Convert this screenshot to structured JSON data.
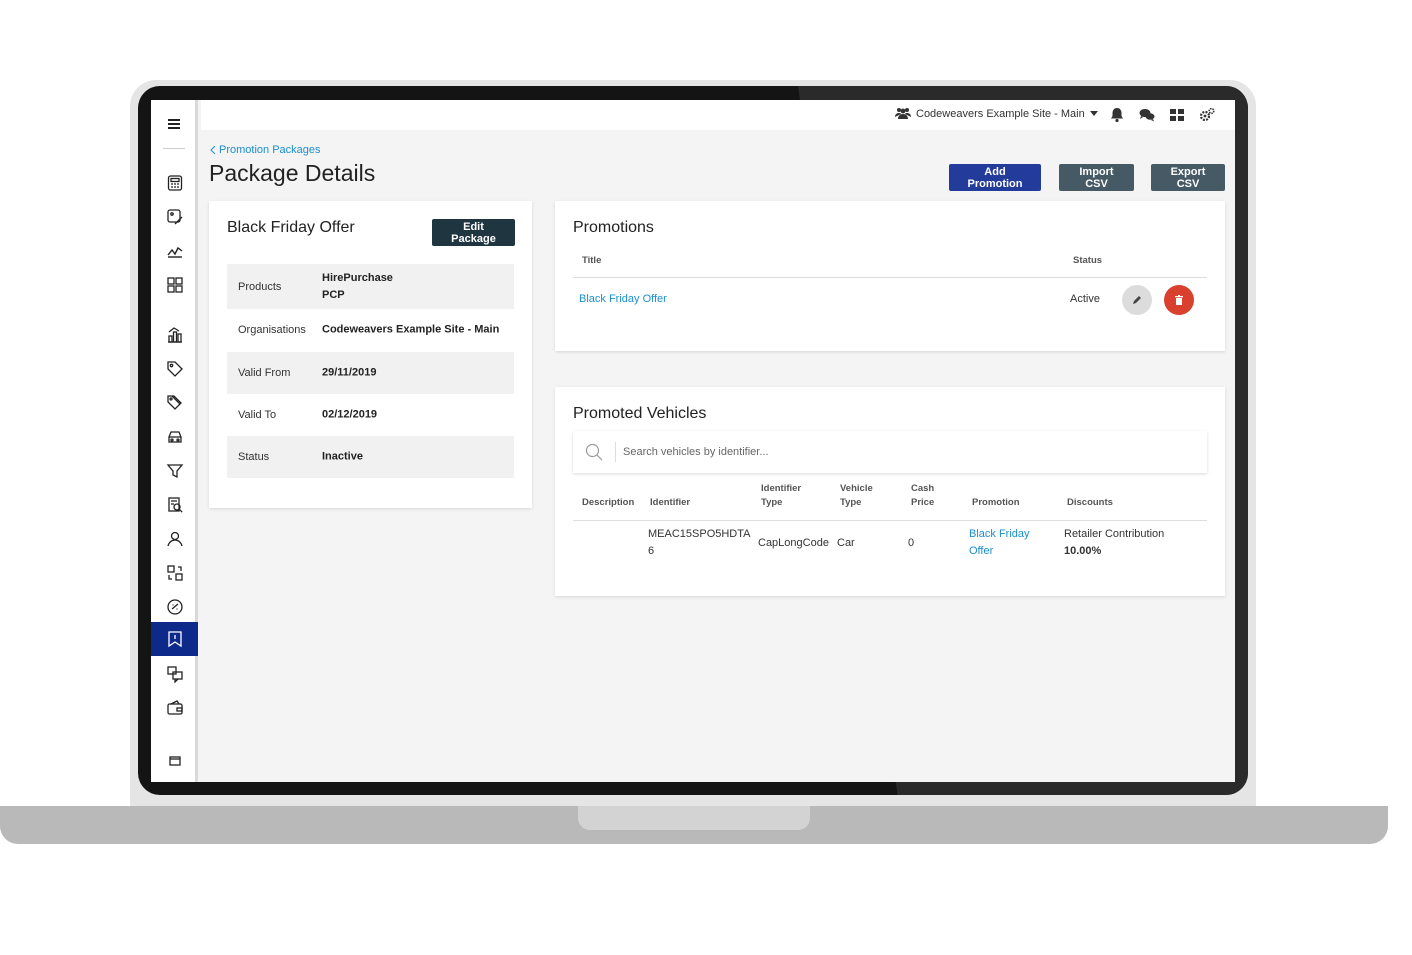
{
  "topbar": {
    "site_name": "Codeweavers Example Site - Main"
  },
  "breadcrumb": {
    "label": "Promotion Packages"
  },
  "page": {
    "title": "Package Details"
  },
  "actions": {
    "add_promotion": "Add Promotion",
    "import_csv": "Import CSV",
    "export_csv": "Export CSV"
  },
  "package": {
    "title": "Black Friday Offer",
    "edit_label": "Edit Package",
    "rows": [
      {
        "label": "Products",
        "value_lines": [
          "HirePurchase",
          "PCP"
        ]
      },
      {
        "label": "Organisations",
        "value": "Codeweavers Example Site - Main"
      },
      {
        "label": "Valid From",
        "value": "29/11/2019"
      },
      {
        "label": "Valid To",
        "value": "02/12/2019"
      },
      {
        "label": "Status",
        "value": "Inactive"
      }
    ]
  },
  "promotions": {
    "title": "Promotions",
    "columns": {
      "title": "Title",
      "status": "Status"
    },
    "rows": [
      {
        "title": "Black Friday Offer",
        "status": "Active"
      }
    ]
  },
  "promoted_vehicles": {
    "title": "Promoted Vehicles",
    "search_placeholder": "Search vehicles by identifier...",
    "columns": {
      "description": "Description",
      "identifier": "Identifier",
      "identifier_type": [
        "Identifier",
        "Type"
      ],
      "vehicle_type": [
        "Vehicle",
        "Type"
      ],
      "cash_price": [
        "Cash",
        "Price"
      ],
      "promotion": "Promotion",
      "discounts": "Discounts"
    },
    "rows": [
      {
        "description": "",
        "identifier_lines": [
          "MEAC15SPO5HDTA",
          "6"
        ],
        "identifier_type": "CapLongCode",
        "vehicle_type": "Car",
        "cash_price": "0",
        "promotion_lines": [
          "Black Friday",
          "Offer"
        ],
        "discount_label": "Retailer Contribution",
        "discount_value": "10.00%"
      }
    ]
  },
  "colors": {
    "primary": "#233c9c",
    "secondary": "#455a64",
    "sidebar_active": "#0d2a8a",
    "link": "#1a8fd0",
    "delete": "#d9402d"
  }
}
